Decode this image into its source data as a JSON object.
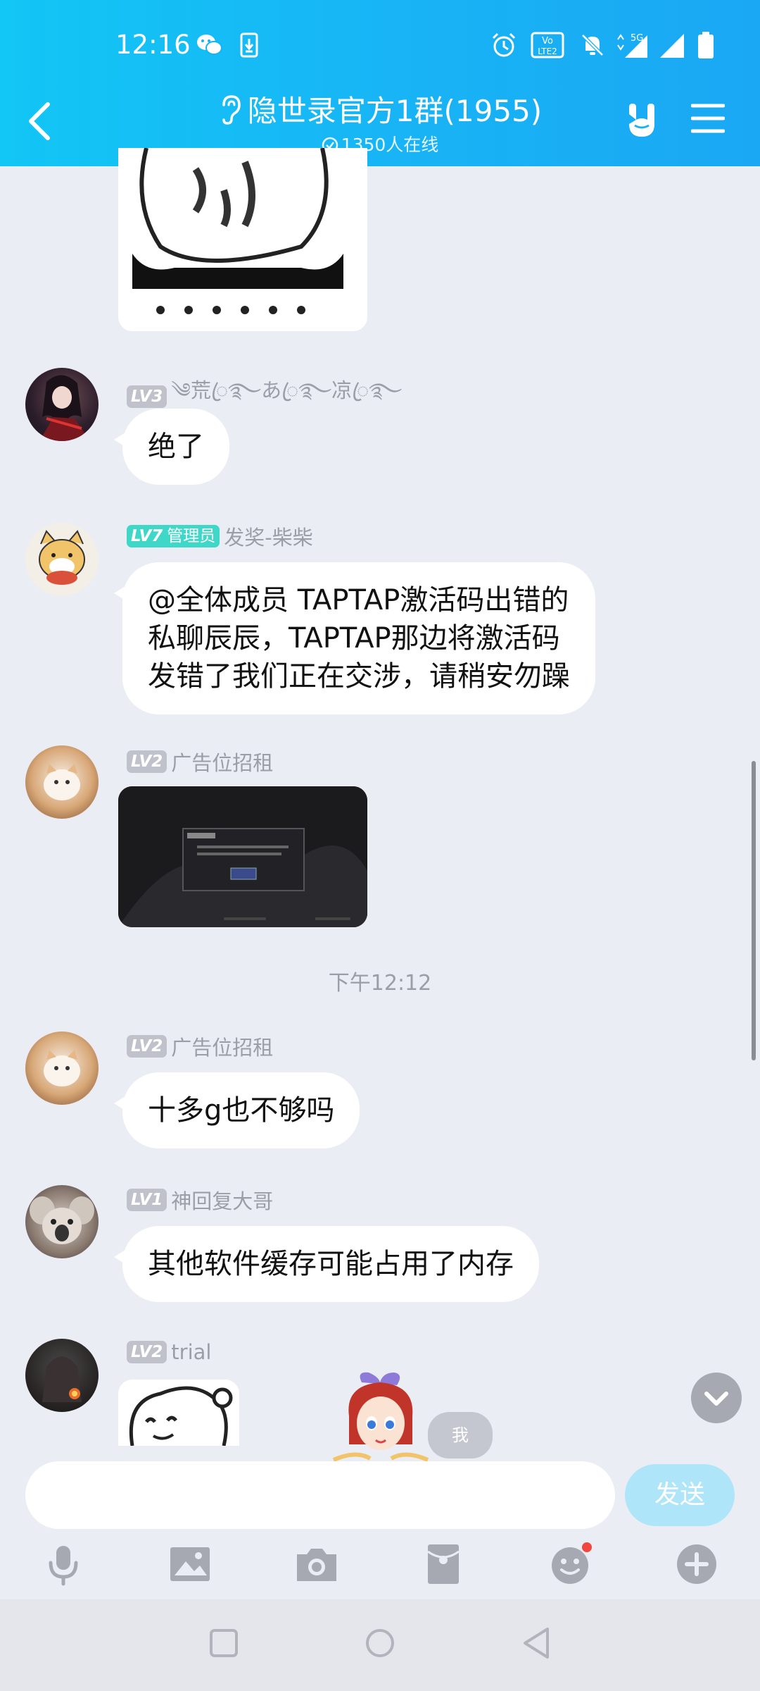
{
  "status_bar": {
    "time": "12:16",
    "icons": [
      "wechat-icon",
      "download-icon",
      "alarm-icon",
      "volte-icon",
      "mute-icon",
      "5g-signal-icon",
      "signal-icon",
      "battery-icon"
    ],
    "volte_text": "VoLTE2",
    "network": "5G"
  },
  "header": {
    "title": "隐世录官方1群(1955)",
    "subtitle": "1350人在线",
    "accent": "#18b3f5"
  },
  "messages": [
    {
      "level": "LV3",
      "name": "༄荒ꦿ࿐あꦿ࿐凉ꦿ࿐",
      "text": "绝了"
    },
    {
      "level": "LV7",
      "role": "管理员",
      "name": "发奖-柴柴",
      "lines": [
        "@全体成员 TAPTAP激活码出错的",
        "私聊辰辰，TAPTAP那边将激活码",
        "发错了我们正在交涉，请稍安勿躁"
      ]
    },
    {
      "level": "LV2",
      "name": "广告位招租",
      "image": "game-screenshot"
    },
    {
      "level": "LV2",
      "name": "广告位招租",
      "text": "十多g也不够吗"
    },
    {
      "level": "LV1",
      "name": "神回复大哥",
      "text": "其他软件缓存可能占用了内存"
    },
    {
      "level": "LV2",
      "name": "trial",
      "image": "sticker"
    }
  ],
  "timestamp": "下午12:12",
  "composer": {
    "placeholder": "",
    "send_label": "发送",
    "me_label": "我"
  },
  "toolbar": [
    "microphone-icon",
    "image-icon",
    "camera-icon",
    "red-packet-icon",
    "emoji-icon",
    "plus-icon"
  ],
  "nav": [
    "recents-icon",
    "home-icon",
    "back-icon"
  ]
}
